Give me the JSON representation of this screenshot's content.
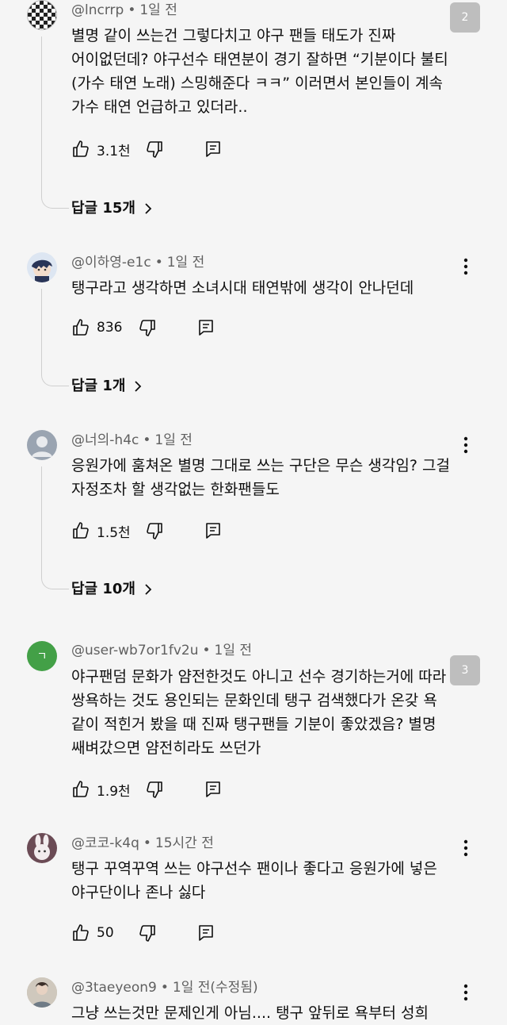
{
  "comments": [
    {
      "author": "@lncrrp",
      "time": "1일 전",
      "text": "별명 같이 쓰는건 그렇다치고 야구 팬들 태도가 진짜 어이없던데? 야구선수 태연분이 경기 잘하면 “기분이다 불티(가수 태연 노래) 스밍해준다 ㅋㅋ” 이러면서 본인들이 계속 가수 태연 언급하고 있더라..",
      "likes": "3.1천",
      "replies": "답글 15개",
      "avatar": "checker-pattern"
    },
    {
      "author": "@이하영-e1c",
      "time": "1일 전",
      "text": "탱구라고 생각하면 소녀시대 태연밖에 생각이 안나던데",
      "likes": "836",
      "replies": "답글 1개",
      "avatar": "anime-character"
    },
    {
      "author": "@너의-h4c",
      "time": "1일 전",
      "text": "응원가에 훔쳐온 별명 그대로 쓰는 구단은 무슨 생각임? 그걸 자정조차 할 생각없는 한화팬들도",
      "likes": "1.5천",
      "replies": "답글 10개",
      "avatar": "default-user"
    },
    {
      "author": "@user-wb7or1fv2u",
      "time": "1일 전",
      "text": "야구팬덤 문화가 얌전한것도 아니고 선수 경기하는거에 따라 쌍욕하는 것도 용인되는 문화인데 탱구 검색했다가 온갖 욕 같이 적힌거 봤을 때 진짜 탱구팬들 기분이 좋았겠음? 별명 쌔벼갔으면 얌전히라도 쓰던가",
      "likes": "1.9천",
      "avatar_letter": "ㄱ",
      "avatar_color": "#43a047"
    },
    {
      "author": "@코코-k4q",
      "time": "15시간 전",
      "text": "탱구 꾸역꾸역 쓰는 야구선수 팬이나 좋다고 응원가에 넣은 야구단이나 존나 싫다",
      "likes": "50",
      "avatar": "bunny"
    },
    {
      "author": "@3taeyeon9",
      "time": "1일 전(수정됨)",
      "text": "그냥 쓰는것만 문제인게 아님.... 탱구 앞뒤로 욕부터 성희",
      "avatar": "photo"
    }
  ],
  "badges": [
    "2",
    "3"
  ]
}
